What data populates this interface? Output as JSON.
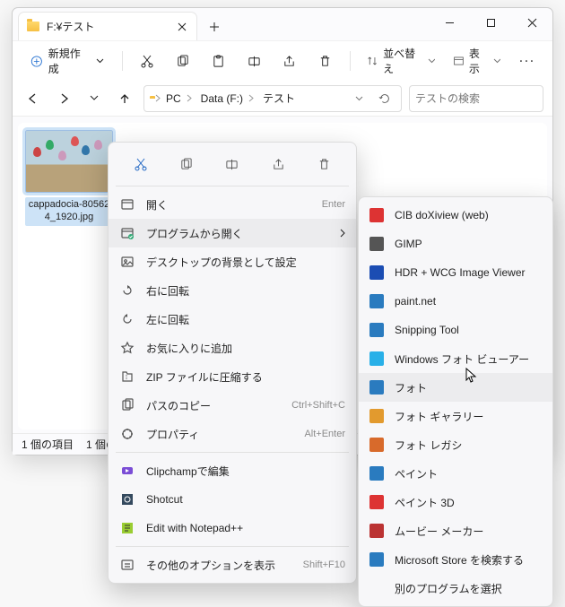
{
  "window": {
    "tab_title": "F:¥テスト",
    "new_btn": "新規作成",
    "sort_label": "並べ替え",
    "view_label": "表示"
  },
  "breadcrumb": [
    "PC",
    "Data (F:)",
    "テスト"
  ],
  "search_placeholder": "テストの検索",
  "file": {
    "name": "cappadocia-805624_1920.jpg"
  },
  "status": {
    "count": "1 個の項目",
    "selected": "1 個の"
  },
  "ctx_icons": [
    "cut",
    "copy",
    "rename",
    "share",
    "delete"
  ],
  "ctx_items": [
    {
      "icon": "open",
      "label": "開く",
      "hint": "Enter"
    },
    {
      "icon": "openwith",
      "label": "プログラムから開く",
      "submenu": true,
      "hov": true
    },
    {
      "icon": "wallpaper",
      "label": "デスクトップの背景として設定"
    },
    {
      "icon": "rot-r",
      "label": "右に回転"
    },
    {
      "icon": "rot-l",
      "label": "左に回転"
    },
    {
      "icon": "star",
      "label": "お気に入りに追加"
    },
    {
      "icon": "zip",
      "label": "ZIP ファイルに圧縮する"
    },
    {
      "icon": "copypath",
      "label": "パスのコピー",
      "hint": "Ctrl+Shift+C"
    },
    {
      "icon": "props",
      "label": "プロパティ",
      "hint": "Alt+Enter"
    },
    {
      "divider": true
    },
    {
      "icon": "clip",
      "label": "Clipchampで編集"
    },
    {
      "icon": "shotcut",
      "label": "Shotcut"
    },
    {
      "icon": "npp",
      "label": "Edit with Notepad++"
    },
    {
      "divider": true
    },
    {
      "icon": "moreopt",
      "label": "その他のオプションを表示",
      "hint": "Shift+F10"
    }
  ],
  "openwith": [
    {
      "color": "#d33",
      "label": "CIB doXiview (web)"
    },
    {
      "color": "#555",
      "label": "GIMP"
    },
    {
      "color": "#1b4db3",
      "label": "HDR + WCG Image Viewer"
    },
    {
      "color": "#2a7bbf",
      "label": "paint.net"
    },
    {
      "color": "#2a7bbf",
      "label": "Snipping Tool"
    },
    {
      "color": "#29b0e8",
      "label": "Windows フォト ビューアー"
    },
    {
      "color": "#2a7bbf",
      "label": "フォト",
      "hov": true
    },
    {
      "color": "#e29a2e",
      "label": "フォト ギャラリー"
    },
    {
      "color": "#d86a2b",
      "label": "フォト レガシ"
    },
    {
      "color": "#2a7bbf",
      "label": "ペイント"
    },
    {
      "color": "#d33",
      "label": "ペイント 3D"
    },
    {
      "color": "#b33",
      "label": "ムービー メーカー"
    },
    {
      "color": "#2a7bbf",
      "label": "Microsoft Store を検索する"
    },
    {
      "nocolor": true,
      "label": "別のプログラムを選択"
    }
  ]
}
